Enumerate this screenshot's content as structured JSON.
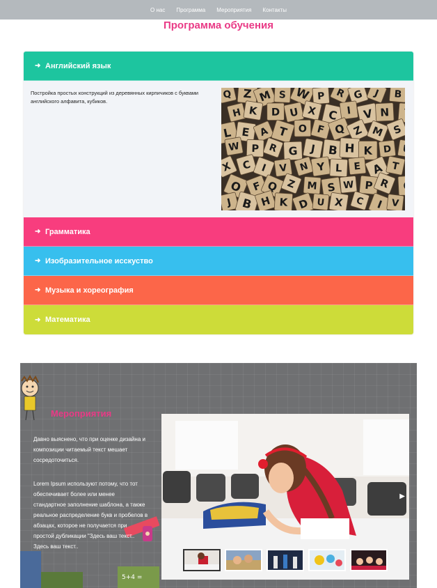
{
  "nav": {
    "items": [
      "О нас",
      "Программа",
      "Мероприятия",
      "Контакты"
    ]
  },
  "page_title": "Программа обучения",
  "accordion": {
    "items": [
      {
        "label": "Английский язык",
        "color": "#1dc59f",
        "open": true,
        "body_text": "Постройка простых конструкций из деревянных кирпичиков с буквами английского алфавита, кубиков."
      },
      {
        "label": "Грамматика",
        "color": "#f83d7e",
        "open": false
      },
      {
        "label": "Изобразительное исскуство",
        "color": "#37bfee",
        "open": false
      },
      {
        "label": "Музыка и хореография",
        "color": "#fc6649",
        "open": false
      },
      {
        "label": "Математика",
        "color": "#cddc39",
        "open": false
      }
    ],
    "icon": "sign-in-icon"
  },
  "events": {
    "title": "Мероприятия",
    "paragraph1": "Давно выяснено, что при оценке дизайна и композиции читаемый текст мешает сосредоточиться.",
    "paragraph2": "Lorem Ipsum используют потому, что тот обеспечивает более или менее стандартное заполнение шаблона, а также реальное распределение букв и пробелов в абзацах, которое не получается при простой дубликации \"Здесь ваш текст.. Здесь ваш текст..",
    "slider": {
      "thumbnail_count": 5,
      "active_thumbnail": 1
    }
  },
  "colors": {
    "nav_bg": "#b4b9bd",
    "title_pink": "#e93a86",
    "events_bg": "#6f7072"
  }
}
